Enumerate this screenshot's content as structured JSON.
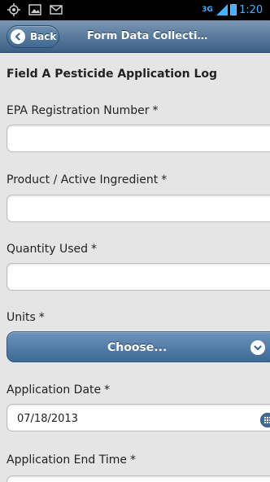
{
  "statusbar": {
    "network_label": "3G",
    "time": "1:20",
    "icons": [
      "gps-icon",
      "picture-icon",
      "gmail-icon",
      "signal-icon",
      "battery-icon"
    ]
  },
  "header": {
    "back_label": "Back",
    "title": "Form Data Collecti…"
  },
  "form": {
    "title": "Field A Pesticide Application Log",
    "required_marker": "*",
    "fields": [
      {
        "label": "EPA Registration Number",
        "value": ""
      },
      {
        "label": "Product / Active Ingredient",
        "value": ""
      },
      {
        "label": "Quantity Used",
        "value": ""
      },
      {
        "label": "Units",
        "select_label": "Choose..."
      },
      {
        "label": "Application Date",
        "value": "07/18/2013"
      },
      {
        "label": "Application End Time",
        "value": ""
      }
    ]
  },
  "colors": {
    "header_accent": "#3b5f84",
    "button_accent": "#3d6a97",
    "statusbar_accent": "#3db2ff"
  }
}
